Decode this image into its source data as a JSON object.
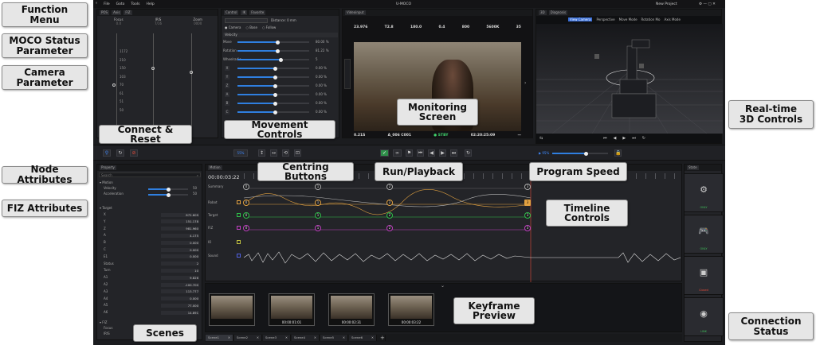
{
  "app": {
    "title": "U-MOCO",
    "project": "New Project",
    "menu": [
      "File",
      "Goto",
      "Tools",
      "Help"
    ]
  },
  "callouts": {
    "function_menu": "Function\nMenu",
    "moco_status": "MOCO Status\nParameter",
    "camera_param": "Camera\nParameter",
    "node_attr": "Node Attributes",
    "fiz_attr": "FIZ Attributes",
    "connect_reset": "Connect & Reset",
    "movement_controls": "Movement Controls",
    "monitoring": "Monitoring\nScreen",
    "realtime_3d": "Real-time\n3D Controls",
    "centring": "Centring Buttons",
    "run_playback": "Run/Playback",
    "program_speed": "Program Speed",
    "timeline": "Timeline\nControls",
    "keyframe": "Keyframe\nPreview",
    "scenes": "Scenes",
    "connection": "Connection\nStatus"
  },
  "status_panel": {
    "tabs": [
      "POS",
      "Axis",
      "FIZ"
    ],
    "columns": [
      {
        "name": "Focus",
        "value": "0.0"
      },
      {
        "name": "IRIS",
        "value": "7/16"
      },
      {
        "name": "Zoom",
        "value": "0000"
      }
    ],
    "focus_marks": [
      "1172",
      "210",
      "150",
      "103",
      "70",
      "61",
      "51",
      "50"
    ]
  },
  "movement": {
    "tabs": [
      "Control",
      "IK",
      "Favorite"
    ],
    "distance": "Distance: 0 mm",
    "radios": [
      "Camera",
      "Base",
      "Follow"
    ],
    "velocity_label": "Velocity",
    "rows": [
      {
        "label": "Move",
        "value": "80.00 %",
        "pct": 0.55
      },
      {
        "label": "Rotation",
        "value": "81.22 %",
        "pct": 0.55
      },
      {
        "label": "Wheelradio",
        "value": "5",
        "pct": 0.6
      },
      {
        "label": "X",
        "value": "0.00 %",
        "pct": 0.52
      },
      {
        "label": "Y",
        "value": "0.00 %",
        "pct": 0.52
      },
      {
        "label": "Z",
        "value": "0.00 %",
        "pct": 0.52
      },
      {
        "label": "A",
        "value": "0.00 %",
        "pct": 0.52
      },
      {
        "label": "B",
        "value": "0.00 %",
        "pct": 0.52
      },
      {
        "label": "C",
        "value": "0.00 %",
        "pct": 0.52
      }
    ]
  },
  "monitor": {
    "tab": "Videoinput",
    "top": [
      "23.976",
      "T2.8",
      "180.0",
      "0.4",
      "800",
      "5600K",
      "35"
    ],
    "bottom": {
      "left": "0.21S",
      "clip": "A_006 C001",
      "state": "● STBY",
      "tc": "02:20:25:09"
    }
  },
  "view3d": {
    "tabs": [
      "3D",
      "Diagnosis"
    ],
    "tools": [
      "View Camera",
      "Perspective",
      "Move Mode",
      "Rotation Mo",
      "Axis Mode"
    ]
  },
  "midbar": {
    "speed_label": "95%",
    "pct_left": "55%"
  },
  "property": {
    "tab": "Property",
    "search": "Search",
    "motion_header": "Motion",
    "velocity": {
      "label": "Velocity",
      "value": "50"
    },
    "accel": {
      "label": "Acceleration",
      "value": "50"
    },
    "target_header": "Target",
    "target_rows": [
      {
        "k": "X",
        "v": "872.609"
      },
      {
        "k": "Y",
        "v": "151.178"
      },
      {
        "k": "Z",
        "v": "981.960"
      },
      {
        "k": "A",
        "v": "4.175"
      },
      {
        "k": "B",
        "v": "0.000"
      },
      {
        "k": "C",
        "v": "0.000"
      },
      {
        "k": "E1",
        "v": "0.000"
      },
      {
        "k": "Status",
        "v": "2"
      },
      {
        "k": "Turn",
        "v": "10"
      },
      {
        "k": "A1",
        "v": "9.826"
      },
      {
        "k": "A2",
        "v": "-100.700"
      },
      {
        "k": "A3",
        "v": "113.777"
      },
      {
        "k": "A4",
        "v": "0.000"
      },
      {
        "k": "A5",
        "v": "77.000"
      },
      {
        "k": "A6",
        "v": "14.891"
      }
    ],
    "fiz_header": "FIZ",
    "fiz_rows": [
      "Focus",
      "IRIS"
    ]
  },
  "timeline": {
    "tab": "Motion",
    "time": "00:00:03:22",
    "tracks": [
      "Summary",
      "Robot",
      "Target",
      "FIZ",
      "IO",
      "Sound"
    ]
  },
  "keyframes": [
    "00:00:01:01",
    "00:00:02:31",
    "00:00:03:22"
  ],
  "scenes": [
    "Scene1",
    "Scene2",
    "Scene3",
    "Scene4",
    "Scene5",
    "Scene6"
  ],
  "connection": {
    "tab": "State",
    "cards": [
      {
        "label": "ONLY",
        "color": "#3fbf5a"
      },
      {
        "label": "ONLY",
        "color": "#3fbf5a"
      },
      {
        "label": "Closed",
        "color": "#e04a3a"
      },
      {
        "label": "LINK",
        "color": "#3fbf5a"
      }
    ]
  }
}
